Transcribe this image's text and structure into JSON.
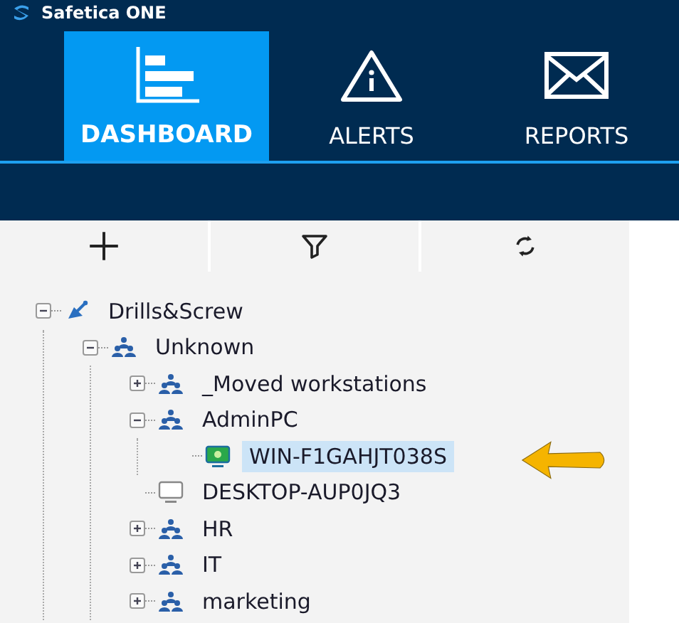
{
  "window": {
    "title": "Safetica ONE"
  },
  "tabs": [
    {
      "label": "DASHBOARD",
      "kind": "dashboard",
      "selected": true
    },
    {
      "label": "ALERTS",
      "kind": "alerts",
      "selected": false
    },
    {
      "label": "REPORTS",
      "kind": "reports",
      "selected": false
    }
  ],
  "toolbar": [
    {
      "kind": "add"
    },
    {
      "kind": "filter"
    },
    {
      "kind": "refresh"
    }
  ],
  "tree": [
    {
      "label": "Drills&Screw",
      "kind": "company",
      "expanded": true,
      "selected": false,
      "children": [
        {
          "label": "Unknown",
          "kind": "group",
          "expanded": true,
          "selected": false,
          "children": [
            {
              "label": "_Moved workstations",
              "kind": "group",
              "expanded": false,
              "selected": false
            },
            {
              "label": "AdminPC",
              "kind": "group",
              "expanded": true,
              "selected": false,
              "children": [
                {
                  "label": "WIN-F1GAHJT038S",
                  "kind": "computer",
                  "online": true,
                  "selected": true
                }
              ]
            },
            {
              "label": "DESKTOP-AUP0JQ3",
              "kind": "computer",
              "online": false,
              "selected": false
            },
            {
              "label": "HR",
              "kind": "group",
              "expanded": false,
              "selected": false
            },
            {
              "label": "IT",
              "kind": "group",
              "expanded": false,
              "selected": false
            },
            {
              "label": "marketing",
              "kind": "group",
              "expanded": false,
              "selected": false
            }
          ]
        }
      ]
    }
  ]
}
